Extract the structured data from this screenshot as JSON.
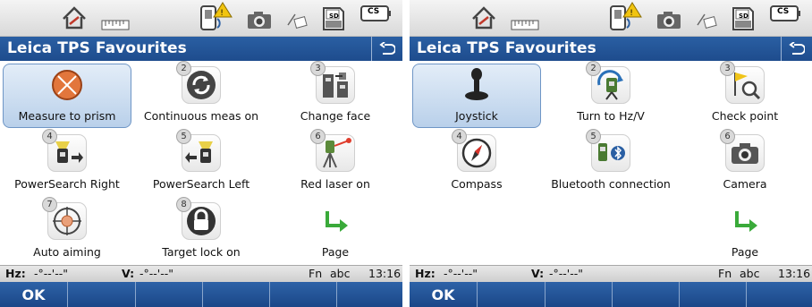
{
  "left": {
    "title": "Leica TPS Favourites",
    "items": [
      {
        "num": "",
        "label": "Measure to prism",
        "icon": "prism-icon"
      },
      {
        "num": "2",
        "label": "Continuous meas on",
        "icon": "continuous-measure-icon"
      },
      {
        "num": "3",
        "label": "Change face",
        "icon": "change-face-icon"
      },
      {
        "num": "4",
        "label": "PowerSearch Right",
        "icon": "powersearch-right-icon"
      },
      {
        "num": "5",
        "label": "PowerSearch Left",
        "icon": "powersearch-left-icon"
      },
      {
        "num": "6",
        "label": "Red laser on",
        "icon": "red-laser-icon"
      },
      {
        "num": "7",
        "label": "Auto aiming",
        "icon": "auto-aiming-icon"
      },
      {
        "num": "8",
        "label": "Target lock on",
        "icon": "target-lock-icon"
      },
      {
        "num": "",
        "label": "Page",
        "icon": "page-arrow-icon"
      }
    ],
    "info": {
      "hz": "Hz:",
      "hz_val": "-°--'--\"",
      "v": "V:",
      "v_val": "-°--'--\"",
      "fn": "Fn",
      "abc": "abc",
      "time": "13:16"
    },
    "softkeys": [
      "OK",
      "",
      "",
      "",
      "",
      ""
    ]
  },
  "right": {
    "title": "Leica TPS Favourites",
    "items": [
      {
        "num": "",
        "label": "Joystick",
        "icon": "joystick-icon"
      },
      {
        "num": "2",
        "label": "Turn to Hz/V",
        "icon": "turn-to-icon"
      },
      {
        "num": "3",
        "label": "Check point",
        "icon": "check-point-icon"
      },
      {
        "num": "4",
        "label": "Compass",
        "icon": "compass-icon"
      },
      {
        "num": "5",
        "label": "Bluetooth connection",
        "icon": "bluetooth-connection-icon"
      },
      {
        "num": "6",
        "label": "Camera",
        "icon": "camera-icon"
      },
      {
        "num": "",
        "label": "",
        "icon": ""
      },
      {
        "num": "",
        "label": "",
        "icon": ""
      },
      {
        "num": "",
        "label": "Page",
        "icon": "page-arrow-icon"
      }
    ],
    "info": {
      "hz": "Hz:",
      "hz_val": "-°--'--\"",
      "v": "V:",
      "v_val": "-°--'--\"",
      "fn": "Fn",
      "abc": "abc",
      "time": "13:16"
    },
    "softkeys": [
      "OK",
      "",
      "",
      "",
      "",
      ""
    ]
  },
  "status": {
    "sd_label": "SD",
    "cs_label": "CS"
  },
  "colors": {
    "title_bar": "#2a5fa3",
    "softkey_bar": "#1b4788",
    "selection": "#b9d0ea"
  }
}
